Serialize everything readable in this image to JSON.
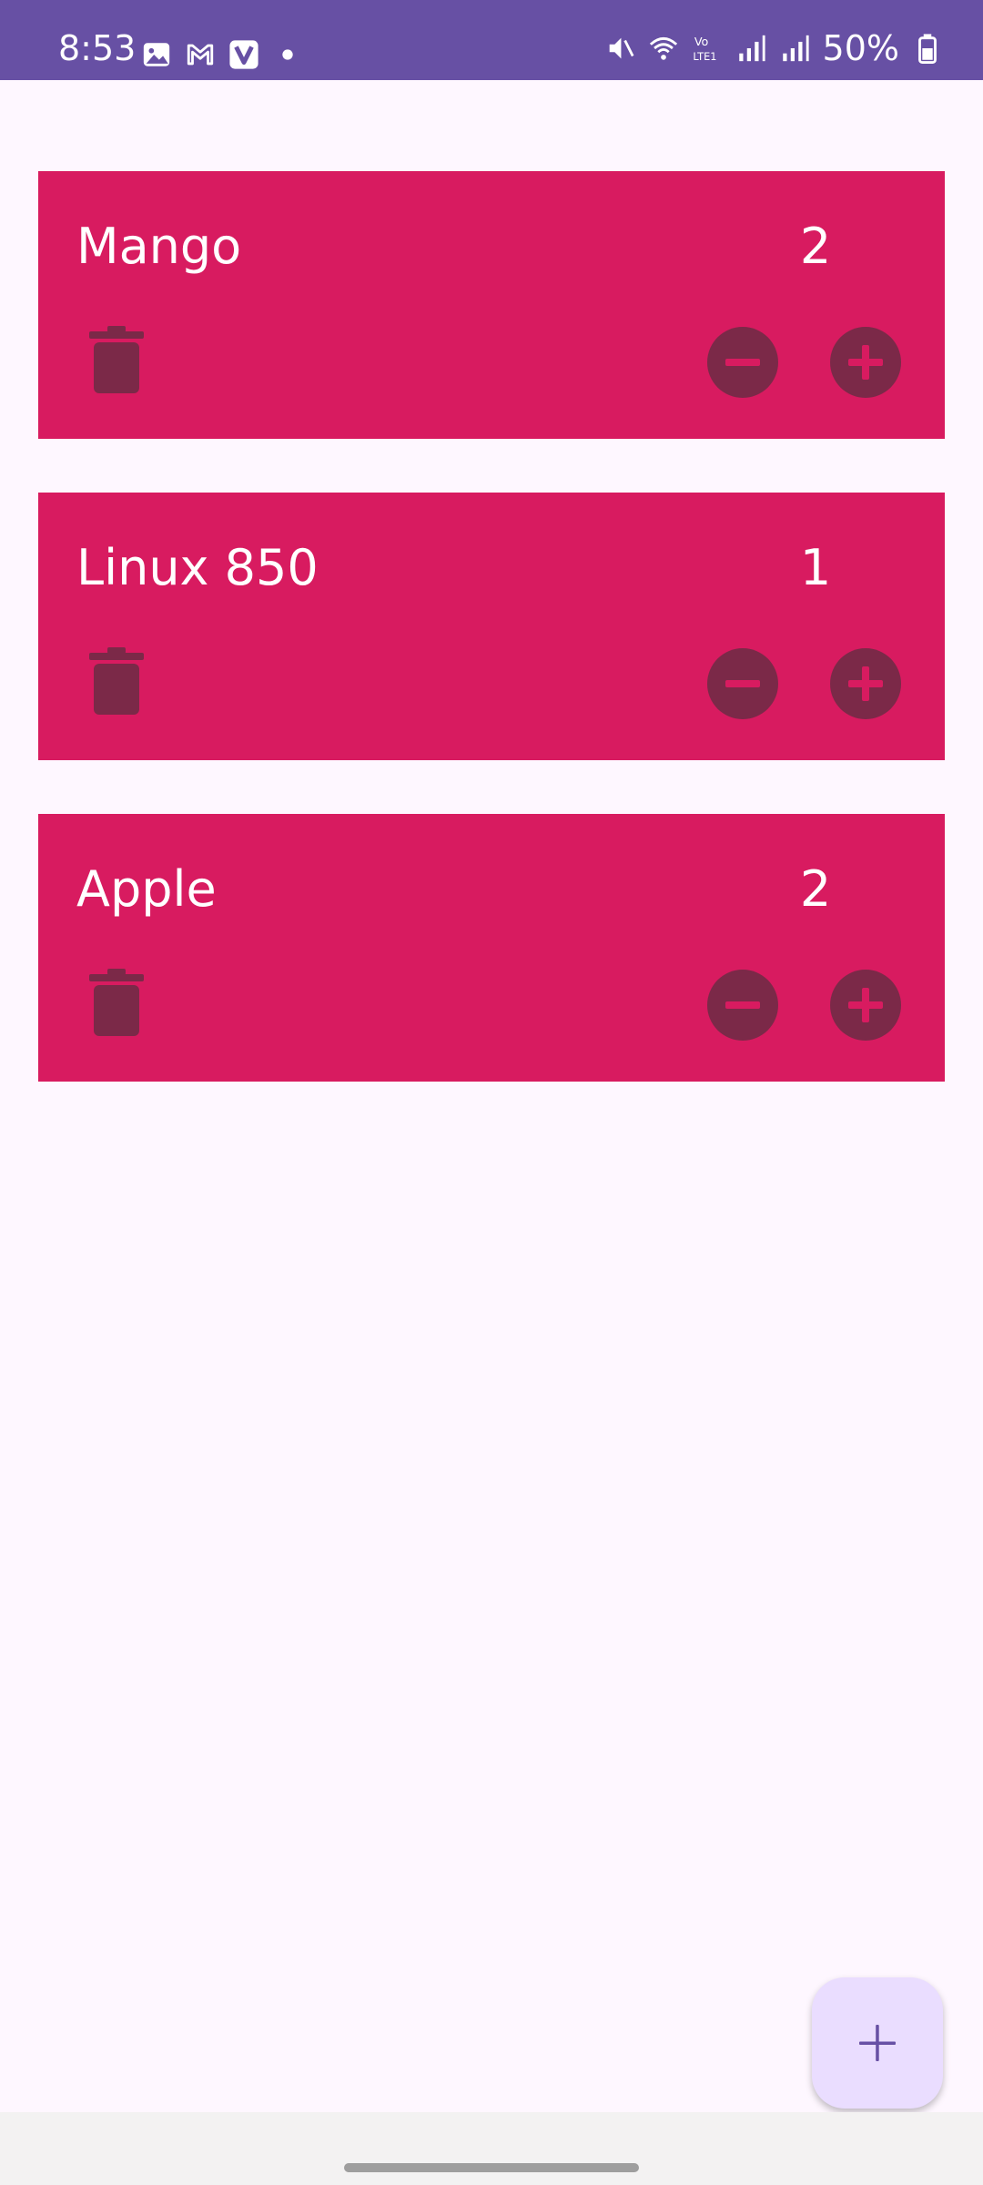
{
  "status_bar": {
    "time": "8:53",
    "battery": "50%",
    "icons_left": [
      "gallery-icon",
      "gmail-icon",
      "v-app-icon",
      "dot-icon"
    ],
    "icons_right": [
      "mute-icon",
      "wifi-icon",
      "volte-icon",
      "signal-icon",
      "signal-icon",
      "battery-icon"
    ],
    "background": "#6750A4"
  },
  "items": [
    {
      "name": "Mango",
      "quantity": "2"
    },
    {
      "name": "Linux 850",
      "quantity": "1"
    },
    {
      "name": "Apple",
      "quantity": "2"
    }
  ],
  "colors": {
    "card": "#D81B60",
    "card_icon": "#7B2948",
    "background": "#FEF7FF",
    "fab": "#EADDFF",
    "fab_icon": "#6750A4"
  },
  "fab": {
    "icon": "plus-icon"
  }
}
